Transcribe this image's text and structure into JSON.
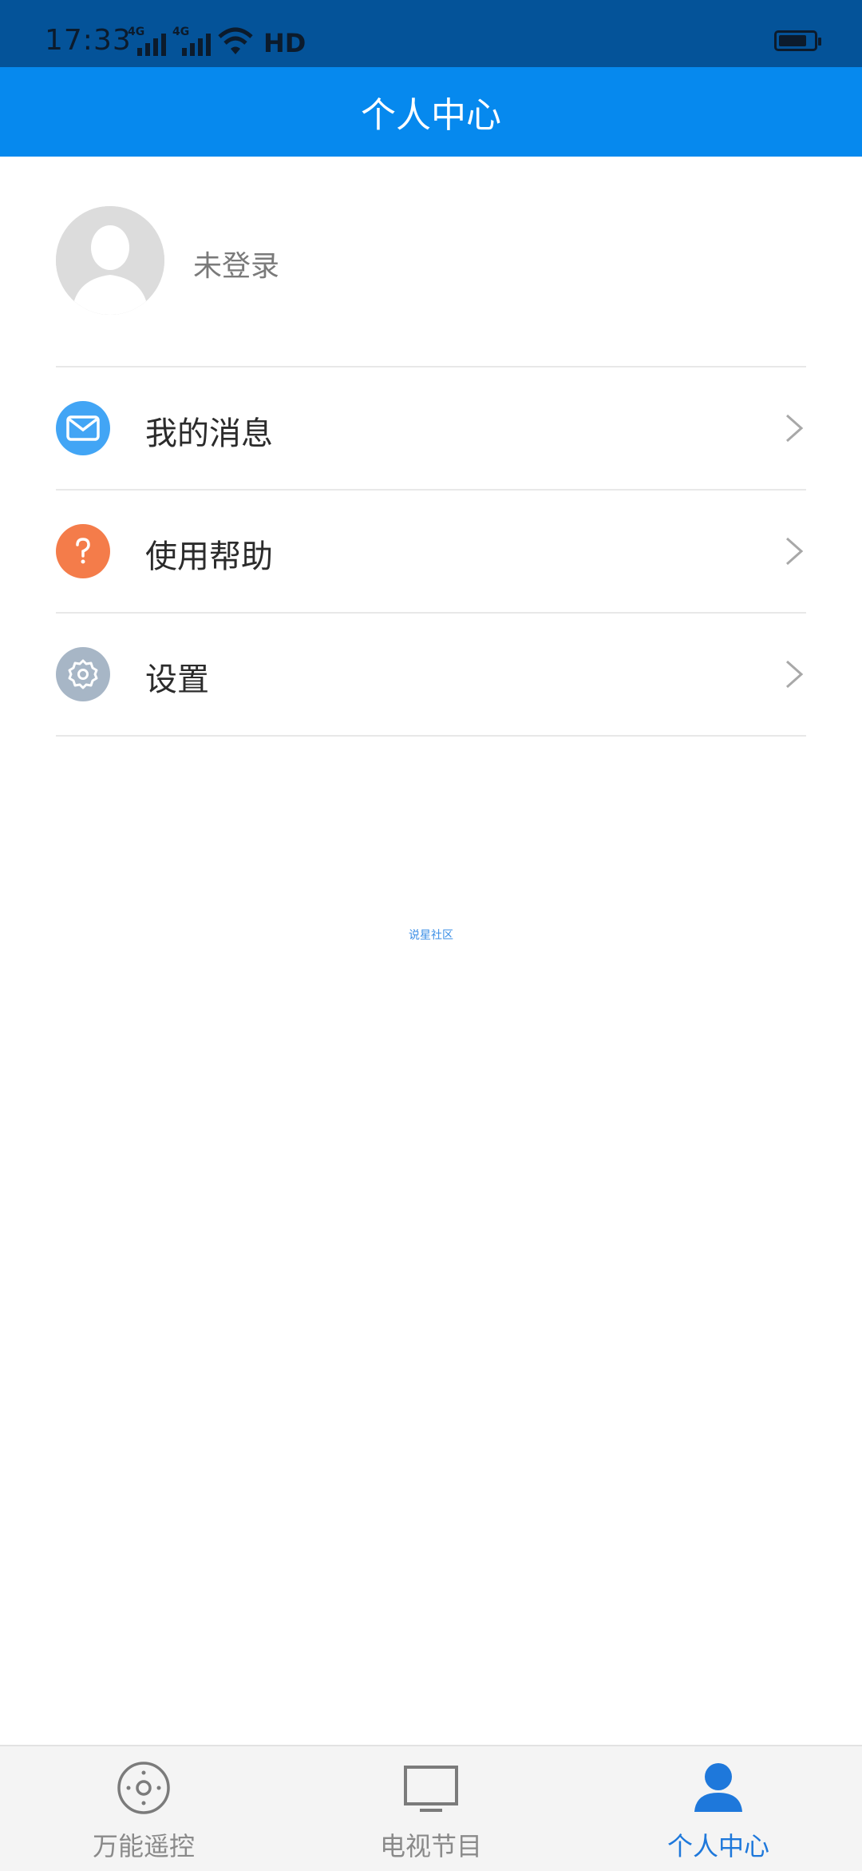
{
  "status_bar": {
    "time": "17:33",
    "network_1": "4G",
    "network_2": "4G",
    "hd": "HD"
  },
  "header": {
    "title": "个人中心"
  },
  "profile": {
    "login_status": "未登录"
  },
  "menu": {
    "items": [
      {
        "label": "我的消息",
        "icon": "mail-icon",
        "color": "#42a5f5"
      },
      {
        "label": "使用帮助",
        "icon": "help-icon",
        "color": "#f47c4a"
      },
      {
        "label": "设置",
        "icon": "gear-icon",
        "color": "#a7b6c6"
      }
    ]
  },
  "footer": {
    "brand_text": "说星社区"
  },
  "bottom_nav": {
    "items": [
      {
        "label": "万能遥控",
        "icon": "remote-icon",
        "active": false
      },
      {
        "label": "电视节目",
        "icon": "tv-icon",
        "active": false
      },
      {
        "label": "个人中心",
        "icon": "user-icon",
        "active": true
      }
    ]
  },
  "colors": {
    "status_bar": "#045399",
    "title_bar": "#0689ee",
    "active_nav": "#1e78db"
  }
}
